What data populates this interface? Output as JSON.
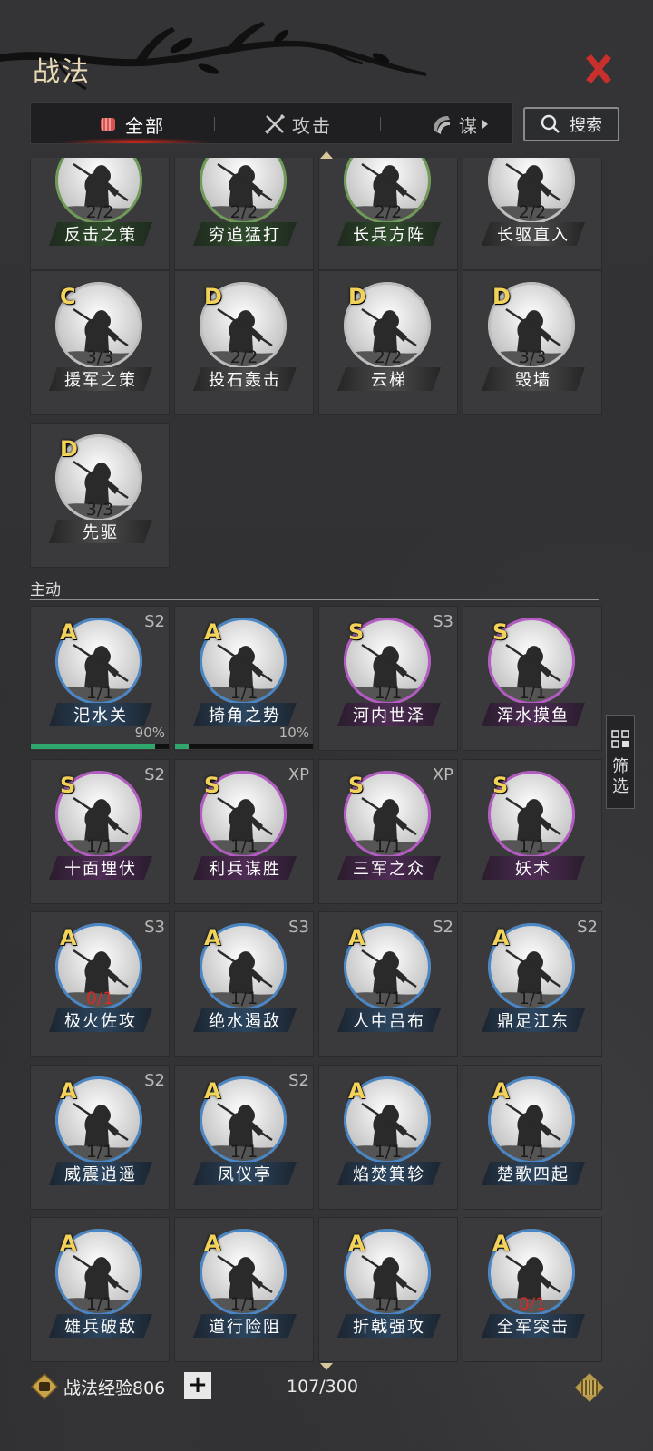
{
  "header": {
    "title": "战法"
  },
  "tabs": [
    {
      "label": "全部",
      "icon": "fist-icon",
      "active": true
    },
    {
      "label": "攻击",
      "icon": "crossed-swords-icon",
      "active": false
    },
    {
      "label": "谋",
      "icon": "fan-icon",
      "active": false
    }
  ],
  "search": {
    "label": "搜索"
  },
  "passive_cards": [
    {
      "name": "反击之策",
      "count": "2/2",
      "grade": "",
      "rarity": "green"
    },
    {
      "name": "穷追猛打",
      "count": "2/2",
      "grade": "",
      "rarity": "green"
    },
    {
      "name": "长兵方阵",
      "count": "2/2",
      "grade": "",
      "rarity": "green"
    },
    {
      "name": "长驱直入",
      "count": "2/2",
      "grade": "",
      "rarity": "gray"
    },
    {
      "name": "援军之策",
      "count": "3/3",
      "grade": "C",
      "rarity": "gray"
    },
    {
      "name": "投石轰击",
      "count": "2/2",
      "grade": "D",
      "rarity": "gray"
    },
    {
      "name": "云梯",
      "count": "2/2",
      "grade": "D",
      "rarity": "gray"
    },
    {
      "name": "毁墙",
      "count": "3/3",
      "grade": "D",
      "rarity": "gray"
    },
    {
      "name": "先驱",
      "count": "3/3",
      "grade": "D",
      "rarity": "gray"
    }
  ],
  "section": {
    "active_label": "主动"
  },
  "active_cards": [
    {
      "name": "汜水关",
      "count": "1/1",
      "grade": "A",
      "season": "S2",
      "rarity": "blue",
      "progress_label": "90%",
      "progress": 0.9
    },
    {
      "name": "掎角之势",
      "count": "1/1",
      "grade": "A",
      "season": "",
      "rarity": "blue",
      "progress_label": "10%",
      "progress": 0.1
    },
    {
      "name": "河内世泽",
      "count": "1/1",
      "grade": "S",
      "season": "S3",
      "rarity": "purple"
    },
    {
      "name": "浑水摸鱼",
      "count": "1/1",
      "grade": "S",
      "season": "",
      "rarity": "purple"
    },
    {
      "name": "十面埋伏",
      "count": "1/1",
      "grade": "S",
      "season": "S2",
      "rarity": "purple"
    },
    {
      "name": "利兵谋胜",
      "count": "1/1",
      "grade": "S",
      "season": "XP",
      "rarity": "purple"
    },
    {
      "name": "三军之众",
      "count": "1/1",
      "grade": "S",
      "season": "XP",
      "rarity": "purple"
    },
    {
      "name": "妖术",
      "count": "1/1",
      "grade": "S",
      "season": "",
      "rarity": "purple"
    },
    {
      "name": "极火佐攻",
      "count": "0/1",
      "grade": "A",
      "season": "S3",
      "rarity": "blue",
      "count_red": true
    },
    {
      "name": "绝水遏敌",
      "count": "1/1",
      "grade": "A",
      "season": "S3",
      "rarity": "blue"
    },
    {
      "name": "人中吕布",
      "count": "1/1",
      "grade": "A",
      "season": "S2",
      "rarity": "blue"
    },
    {
      "name": "鼎足江东",
      "count": "1/1",
      "grade": "A",
      "season": "S2",
      "rarity": "blue"
    },
    {
      "name": "威震逍遥",
      "count": "1/1",
      "grade": "A",
      "season": "S2",
      "rarity": "blue"
    },
    {
      "name": "凤仪亭",
      "count": "1/1",
      "grade": "A",
      "season": "S2",
      "rarity": "blue"
    },
    {
      "name": "焰焚箕轸",
      "count": "1/1",
      "grade": "A",
      "season": "",
      "rarity": "blue"
    },
    {
      "name": "楚歌四起",
      "count": "1/1",
      "grade": "A",
      "season": "",
      "rarity": "blue"
    },
    {
      "name": "雄兵破敌",
      "count": "1/1",
      "grade": "A",
      "season": "",
      "rarity": "blue"
    },
    {
      "name": "道行险阻",
      "count": "1/1",
      "grade": "A",
      "season": "",
      "rarity": "blue"
    },
    {
      "name": "折戟强攻",
      "count": "1/1",
      "grade": "A",
      "season": "",
      "rarity": "blue"
    },
    {
      "name": "全军突击",
      "count": "0/1",
      "grade": "A",
      "season": "",
      "rarity": "blue",
      "count_red": true
    }
  ],
  "filter": {
    "label": "筛选"
  },
  "footer": {
    "exp_label": "战法经验806",
    "plus": "+",
    "capacity": "107/300"
  },
  "colors": {
    "accent_gold": "#f3d25a",
    "close_red": "#c9302c",
    "progress_green": "#2fa66b"
  }
}
